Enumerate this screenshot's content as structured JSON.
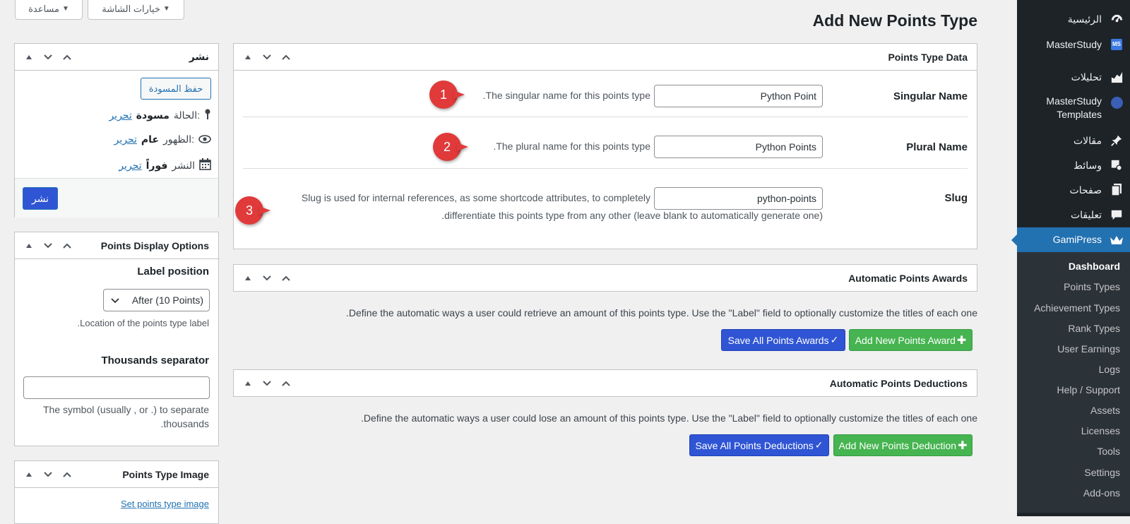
{
  "top_tabs": {
    "screen_options": "خيارات الشاشة",
    "help": "مساعدة"
  },
  "page_title": "Add New Points Type",
  "sidebar": {
    "items": [
      {
        "label": "الرئيسية",
        "icon": "dashboard-icon"
      },
      {
        "label": "MasterStudy",
        "icon": "masterstudy-icon"
      },
      {
        "label": "تحليلات",
        "icon": "analytics-icon"
      },
      {
        "label": "MasterStudy Templates",
        "icon": "templates-icon"
      },
      {
        "label": "مقالات",
        "icon": "pin-icon"
      },
      {
        "label": "وسائط",
        "icon": "media-icon"
      },
      {
        "label": "صفحات",
        "icon": "pages-icon"
      },
      {
        "label": "تعليقات",
        "icon": "comments-icon"
      },
      {
        "label": "GamiPress",
        "icon": "crown-icon"
      }
    ],
    "submenu": [
      "Dashboard",
      "Points Types",
      "Achievement Types",
      "Rank Types",
      "User Earnings",
      "Logs",
      "Help / Support",
      "Assets",
      "Licenses",
      "Tools",
      "Settings",
      "Add-ons"
    ]
  },
  "points_type_data": {
    "title": "Points Type Data",
    "singular": {
      "label": "Singular Name",
      "value": "Python Point",
      "desc": "The singular name for this points type."
    },
    "plural": {
      "label": "Plural Name",
      "value": "Python Points",
      "desc": "The plural name for this points type."
    },
    "slug": {
      "label": "Slug",
      "value": "python-points",
      "desc_line1": "Slug is used for internal references, as some shortcode attributes, to completely",
      "desc_line2": "differentiate this points type from any other (leave blank to automatically generate one)."
    },
    "badges": [
      "1",
      "2",
      "3"
    ]
  },
  "awards": {
    "title": "Automatic Points Awards",
    "desc": "Define the automatic ways a user could retrieve an amount of this points type. Use the \"Label\" field to optionally customize the titles of each one.",
    "save_label": "Save All Points Awards",
    "add_label": "Add New Points Award"
  },
  "deductions": {
    "title": "Automatic Points Deductions",
    "desc": "Define the automatic ways a user could lose an amount of this points type. Use the \"Label\" field to optionally customize the titles of each one.",
    "save_label": "Save All Points Deductions",
    "add_label": "Add New Points Deduction"
  },
  "publish": {
    "title": "نشر",
    "save_draft": "حفظ المسودة",
    "status_label": "الحالة:",
    "status_value": "مسودة",
    "visibility_label": "الظهور:",
    "visibility_value": "عام",
    "schedule_label": "النشر",
    "schedule_value": "فوراً",
    "edit_link": "تحرير",
    "publish_button": "نشر"
  },
  "display_options": {
    "title": "Points Display Options",
    "label_position_title": "Label position",
    "label_position_value": "After (10 Points)",
    "label_position_desc": "Location of the points type label.",
    "thousands_title": "Thousands separator",
    "thousands_value": "",
    "thousands_desc_line1": "The symbol (usually , or .) to separate",
    "thousands_desc_line2": "thousands."
  },
  "points_image": {
    "title": "Points Type Image",
    "set_link": "Set points type image"
  },
  "colors": {
    "sidebar_bg": "#1d2327",
    "active_menu": "#2271b1",
    "save_button": "#2f55d4",
    "add_button": "#46b450",
    "badge": "#e03a3a"
  }
}
